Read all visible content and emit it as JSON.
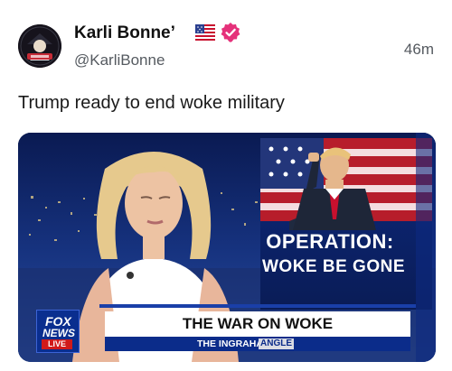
{
  "post": {
    "display_name": "Karli Bonne’",
    "handle": "@KarliBonne",
    "timestamp": "46m",
    "text": "Trump ready to end woke military",
    "avatar_icon": "avatar-image",
    "flag_icon": "us-flag-icon",
    "verified_icon": "verified-badge-icon",
    "verified_color": "#e5317a"
  },
  "media": {
    "graphic_line1": "OPERATION:",
    "graphic_line2": "WOKE BE GONE",
    "headline": "THE WAR ON WOKE",
    "show_name": "THE INGRAHAM",
    "show_name_tag": "ANGLE",
    "logo_line1": "FOX",
    "logo_line2": "NEWS",
    "logo_live": "LIVE",
    "brand_blue": "#0b2c8a",
    "alert_red": "#d11a1a"
  }
}
